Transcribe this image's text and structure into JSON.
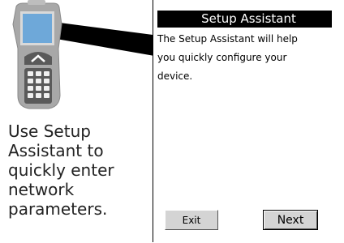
{
  "caption": {
    "lines": [
      "Use Setup",
      "Assistant to",
      "quickly enter",
      "network",
      "parameters."
    ]
  },
  "screen": {
    "title": "Setup Assistant",
    "body_lines": [
      "The Setup Assistant will help",
      "you quickly configure your",
      "device."
    ],
    "exit_label": "Exit",
    "next_label": "Next"
  },
  "colors": {
    "title_bar": "#000000",
    "device_screen": "#6ea8d9",
    "device_body": "#a6a6a6",
    "button_face": "#d4d4d4"
  }
}
